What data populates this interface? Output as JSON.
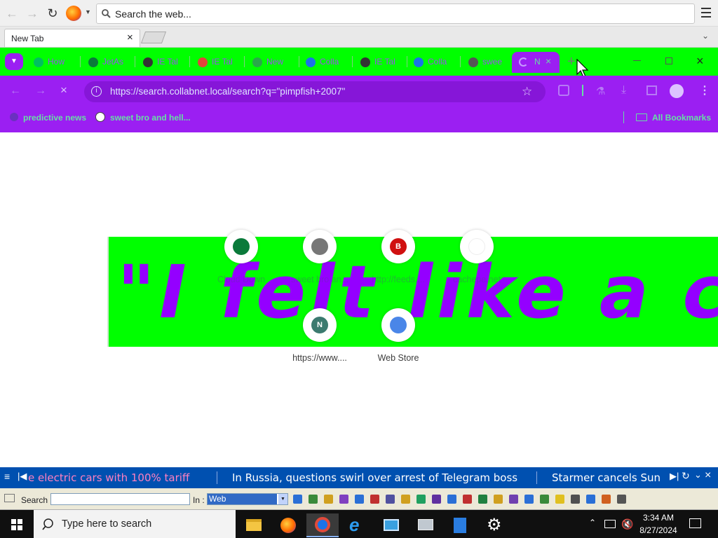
{
  "firefox": {
    "search_placeholder": "Search the web...",
    "tab_label": "New Tab"
  },
  "chrome_tabs": [
    {
      "label": "How",
      "color": "#00c060"
    },
    {
      "label": "JetAs",
      "color": "#0a7a3a"
    },
    {
      "label": "IE Tal",
      "color": "#333333"
    },
    {
      "label": "IE Tal",
      "color": "#e0453a"
    },
    {
      "label": "New",
      "color": "#2aa84a"
    },
    {
      "label": "Colla",
      "color": "#1a73e8"
    },
    {
      "label": "IE Tal",
      "color": "#333333"
    },
    {
      "label": "Colla",
      "color": "#1a73e8"
    },
    {
      "label": "swee",
      "color": "#555555"
    }
  ],
  "active_tab": {
    "label": "N"
  },
  "address": {
    "url": "https://search.collabnet.local/search?q=\"pimpfish+2007\""
  },
  "bookmarks": {
    "left": [
      {
        "label": "predictive news"
      },
      {
        "label": "sweet bro and hell..."
      }
    ],
    "right": "All Bookmarks"
  },
  "banner": {
    "text": "\"I felt like a ca"
  },
  "shortcuts": [
    {
      "label": "Cloud Down",
      "initial": "",
      "color": "#0a7a3a"
    },
    {
      "label": "sweet bro an...",
      "initial": "",
      "color": "#777777"
    },
    {
      "label": "http://feeds....",
      "initial": "B",
      "color": "#d01010"
    },
    {
      "label": "cachepe.net",
      "initial": "",
      "color": "#ffffff"
    },
    {
      "label": "https://www....",
      "initial": "N",
      "color": "#3c7a6f"
    },
    {
      "label": "Web Store",
      "initial": "",
      "color": "#4a86e8"
    }
  ],
  "ticker": {
    "items": [
      "e electric cars with 100% tariff",
      "In Russia, questions swirl over arrest of Telegram boss",
      "Starmer cancels Sun"
    ]
  },
  "search_toolbar": {
    "search_label": "Search :",
    "in_label": "In :",
    "in_value": "Web"
  },
  "taskbar": {
    "search_placeholder": "Type here to search",
    "time": "3:34 AM",
    "date": "8/27/2024"
  }
}
